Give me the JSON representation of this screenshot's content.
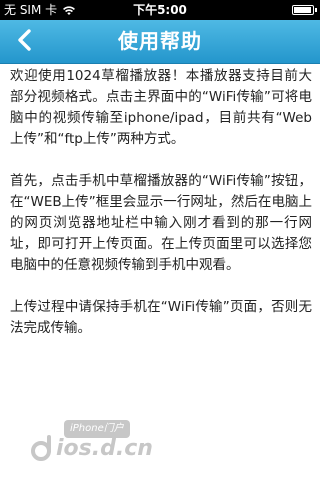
{
  "status_bar": {
    "carrier": "无 SIM 卡",
    "time": "下午5:00",
    "icons": [
      "wifi-icon",
      "battery-icon"
    ]
  },
  "nav": {
    "back_icon": "chevron-left-icon",
    "title": "使用帮助"
  },
  "content": {
    "paragraphs": [
      "欢迎使用1024草榴播放器！本播放器支持目前大部分视频格式。点击主界面中的“WiFi传输”可将电脑中的视频传输至iphone/ipad，目前共有“Web上传”和“ftp上传”两种方式。",
      "首先，点击手机中草榴播放器的“WiFi传输”按钮，在“WEB上传”框里会显示一行网址，然后在电脑上的网页浏览器地址栏中输入刚才看到的那一行网址，即可打开上传页面。在上传页面里可以选择您电脑中的任意视频传输到手机中观看。",
      "上传过程中请保持手机在“WiFi传输”页面，否则无法完成传输。"
    ]
  },
  "watermark": {
    "badge": "iPhone门户",
    "text": "ios.d.cn"
  },
  "colors": {
    "nav_top": "#4fb9e4",
    "nav_bottom": "#2496cc",
    "status_bg": "#000000",
    "text": "#222222"
  }
}
